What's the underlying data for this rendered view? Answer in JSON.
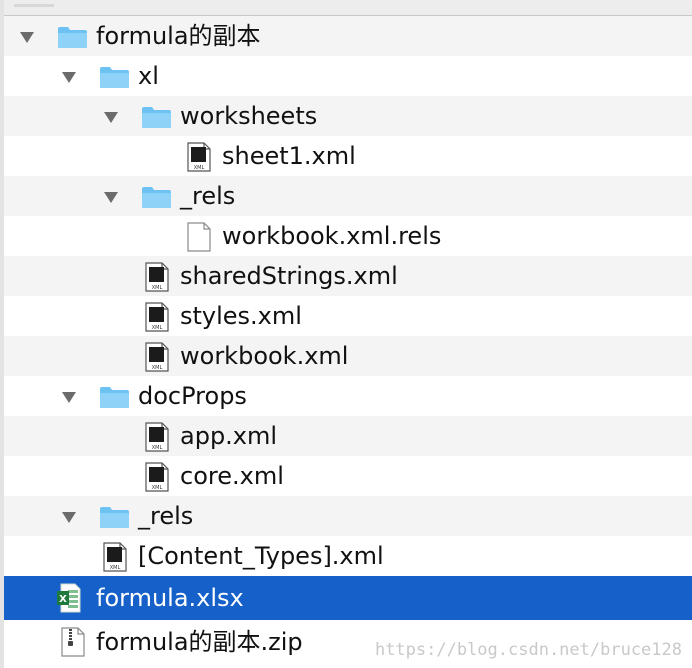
{
  "tree": {
    "items": [
      {
        "label": "formula的副本",
        "icon": "folder-icon",
        "expanded": true
      },
      {
        "label": "xl",
        "icon": "folder-icon",
        "expanded": true
      },
      {
        "label": "worksheets",
        "icon": "folder-icon",
        "expanded": true
      },
      {
        "label": "sheet1.xml",
        "icon": "xml-file-icon"
      },
      {
        "label": "_rels",
        "icon": "folder-icon",
        "expanded": true
      },
      {
        "label": "workbook.xml.rels",
        "icon": "blank-file-icon"
      },
      {
        "label": "sharedStrings.xml",
        "icon": "xml-file-icon"
      },
      {
        "label": "styles.xml",
        "icon": "xml-file-icon"
      },
      {
        "label": "workbook.xml",
        "icon": "xml-file-icon"
      },
      {
        "label": "docProps",
        "icon": "folder-icon",
        "expanded": true
      },
      {
        "label": "app.xml",
        "icon": "xml-file-icon"
      },
      {
        "label": "core.xml",
        "icon": "xml-file-icon"
      },
      {
        "label": "_rels",
        "icon": "folder-icon",
        "expanded": true
      },
      {
        "label": "[Content_Types].xml",
        "icon": "xml-file-icon"
      },
      {
        "label": "formula.xlsx",
        "icon": "excel-file-icon",
        "selected": true
      },
      {
        "label": "formula的副本.zip",
        "icon": "zip-file-icon"
      }
    ],
    "file_badge": "XML",
    "excel_badge": "X"
  },
  "watermark": "https://blog.csdn.net/bruce128",
  "colors": {
    "selection": "#1560c9",
    "folder": "#6cc3f3",
    "stripe": "#f4f4f4"
  }
}
